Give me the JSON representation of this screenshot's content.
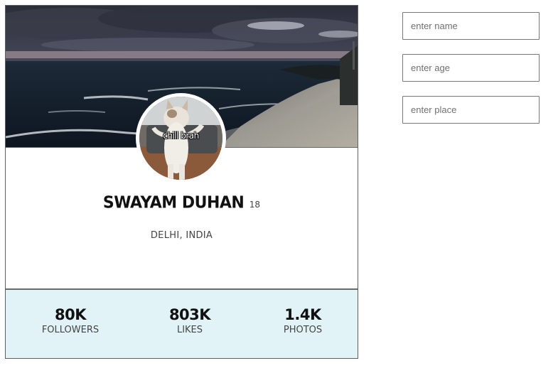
{
  "profile": {
    "cover_image": "beach-at-dusk",
    "avatar_image": "standing-cat",
    "avatar_caption": "chill brah",
    "name": "SWAYAM DUHAN",
    "age": "18",
    "location": "DELHI, INDIA"
  },
  "stats": [
    {
      "value": "80K",
      "label": "FOLLOWERS"
    },
    {
      "value": "803K",
      "label": "LIKES"
    },
    {
      "value": "1.4K",
      "label": "PHOTOS"
    }
  ],
  "form": {
    "name_placeholder": "enter name",
    "age_placeholder": "enter age",
    "place_placeholder": "enter place"
  },
  "colors": {
    "stats_background": "#e2f3f8",
    "card_border": "#5f5f5f"
  }
}
